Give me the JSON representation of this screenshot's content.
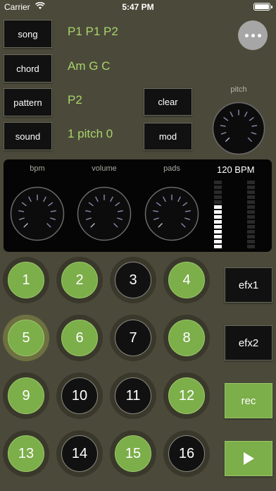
{
  "status_bar": {
    "carrier": "Carrier",
    "time": "5:47 PM"
  },
  "left_buttons": [
    {
      "label": "song",
      "value": "P1 P1 P2"
    },
    {
      "label": "chord",
      "value": "Am G C"
    },
    {
      "label": "pattern",
      "value": "P2"
    },
    {
      "label": "sound",
      "value": "1 pitch 0"
    }
  ],
  "mid_buttons": {
    "clear": "clear",
    "mod": "mod"
  },
  "pitch": {
    "label": "pitch"
  },
  "panel": {
    "knobs": [
      {
        "label": "bpm"
      },
      {
        "label": "volume"
      },
      {
        "label": "pads"
      }
    ],
    "bpm_readout": "120 BPM"
  },
  "meters": {
    "left_level": 0.65,
    "right_level": 0.0,
    "on_color": "#ffffff",
    "off_color": "#2a2a2a"
  },
  "pads": [
    {
      "number": "1",
      "state": "green"
    },
    {
      "number": "2",
      "state": "green"
    },
    {
      "number": "3",
      "state": "black"
    },
    {
      "number": "4",
      "state": "green"
    },
    {
      "number": "5",
      "state": "green",
      "active": true
    },
    {
      "number": "6",
      "state": "green"
    },
    {
      "number": "7",
      "state": "black"
    },
    {
      "number": "8",
      "state": "green"
    },
    {
      "number": "9",
      "state": "green"
    },
    {
      "number": "10",
      "state": "black"
    },
    {
      "number": "11",
      "state": "black"
    },
    {
      "number": "12",
      "state": "green"
    },
    {
      "number": "13",
      "state": "green"
    },
    {
      "number": "14",
      "state": "black"
    },
    {
      "number": "15",
      "state": "green"
    },
    {
      "number": "16",
      "state": "black"
    }
  ],
  "right_buttons": {
    "efx1": "efx1",
    "efx2": "efx2",
    "rec": "rec",
    "play_icon": "play-icon"
  },
  "colors": {
    "background": "#4b4a3a",
    "accent_green": "#7cae4a",
    "value_text": "#a9d46a"
  }
}
